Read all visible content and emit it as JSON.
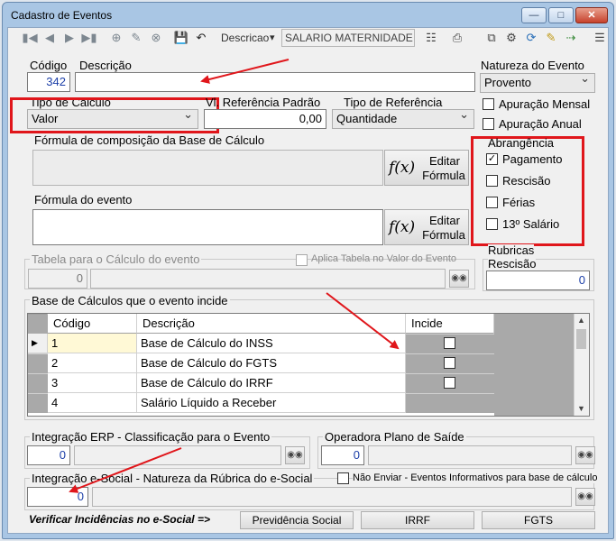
{
  "window": {
    "title": "Cadastro de Eventos"
  },
  "toolbar": {
    "descricao_label": "Descricao",
    "search_value": "SALARIO MATERNIDADE"
  },
  "codigo": {
    "label": "Código",
    "value": "342"
  },
  "descricao": {
    "label": "Descrição",
    "value": ""
  },
  "natureza": {
    "label": "Natureza do Evento",
    "value": "Provento"
  },
  "apuracao_mensal": "Apuração Mensal",
  "apuracao_anual": "Apuração Anual",
  "tipo_calculo": {
    "label": "Tipo de Cálculo",
    "value": "Valor"
  },
  "vl_ref": {
    "label": "Vl. Referência Padrão",
    "value": "0,00"
  },
  "tipo_ref": {
    "label": "Tipo de Referência",
    "value": "Quantidade"
  },
  "formula_base": {
    "label": "Fórmula de composição da Base de Cálculo",
    "btn_line1": "Editar",
    "btn_line2": "Fórmula"
  },
  "formula_evento": {
    "label": "Fórmula do evento",
    "btn_line1": "Editar",
    "btn_line2": "Fórmula"
  },
  "fx_symbol": "f(x)",
  "abrangencia": {
    "title": "Abrangência",
    "items": [
      {
        "label": "Pagamento",
        "checked": true
      },
      {
        "label": "Rescisão",
        "checked": false
      },
      {
        "label": "Férias",
        "checked": false
      },
      {
        "label": "13º Salário",
        "checked": false
      }
    ]
  },
  "tabela": {
    "label": "Tabela para o Cálculo do evento",
    "value": "0",
    "aplica_label": "Aplica Tabela no Valor do Evento"
  },
  "rubricas": {
    "label_line1": "Rubricas",
    "label_line2": "Rescisão",
    "value": "0"
  },
  "base_calculos": {
    "title": "Base de Cálculos que o evento incide",
    "columns": [
      "Código",
      "Descrição",
      "Incide"
    ],
    "rows": [
      {
        "codigo": "1",
        "descricao": "Base de Cálculo do INSS"
      },
      {
        "codigo": "2",
        "descricao": "Base de Cálculo do FGTS"
      },
      {
        "codigo": "3",
        "descricao": "Base de Cálculo do IRRF"
      },
      {
        "codigo": "4",
        "descricao": "Salário Líquido a Receber"
      }
    ]
  },
  "integracao_erp": {
    "label": "Integração ERP - Classificação para o Evento",
    "value": "0"
  },
  "operadora": {
    "label": "Operadora Plano de Saíde",
    "value": "0"
  },
  "esocial": {
    "label": "Integração e-Social - Natureza da Rúbrica do e-Social",
    "value": "0",
    "nao_enviar_label": "Não Enviar - Eventos Informativos para base de cálculo"
  },
  "footer": {
    "verificar_label": "Verificar Incidências no e-Social =>",
    "btn_previdencia": "Previdência Social",
    "btn_irrf": "IRRF",
    "btn_fgts": "FGTS"
  },
  "colors": {
    "red_annotation": "#e0161b",
    "title_blue": "#a9c6e4"
  }
}
